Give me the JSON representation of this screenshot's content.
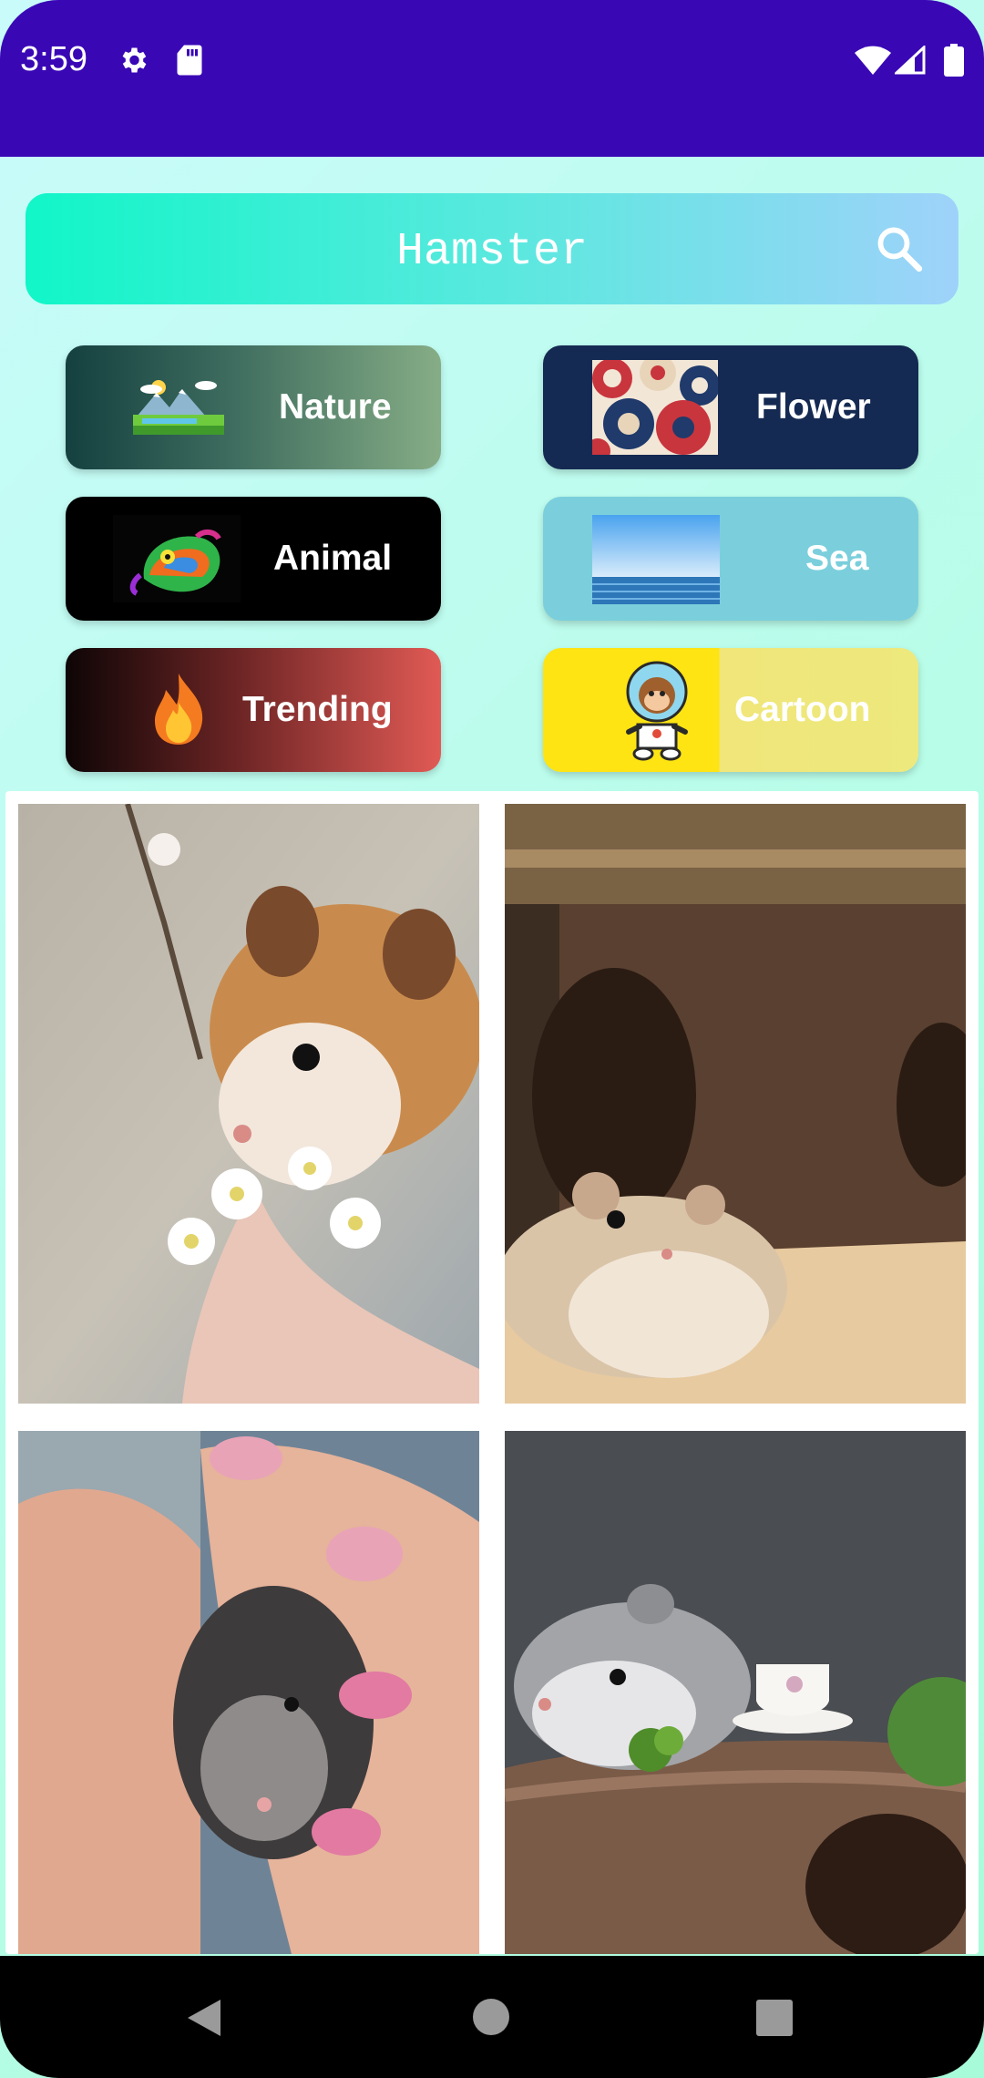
{
  "status_bar": {
    "time": "3:59",
    "left_icons": [
      "gear-icon",
      "sd-card-icon"
    ],
    "right_icons": [
      "wifi-icon",
      "signal-icon",
      "battery-icon"
    ],
    "background": "#3a07b5"
  },
  "search": {
    "value": "Hamster",
    "icon": "search-icon"
  },
  "categories": [
    {
      "label": "Nature",
      "icon": "nature-thumbnail"
    },
    {
      "label": "Flower",
      "icon": "flower-thumbnail"
    },
    {
      "label": "Animal",
      "icon": "chameleon-thumbnail"
    },
    {
      "label": "Sea",
      "icon": "sea-thumbnail"
    },
    {
      "label": "Trending",
      "icon": "fire-icon"
    },
    {
      "label": "Cartoon",
      "icon": "astronaut-monkey-thumbnail"
    }
  ],
  "results": [
    {
      "subject": "hamster-with-blossoms"
    },
    {
      "subject": "hamster-in-wooden-house"
    },
    {
      "subject": "hamster-in-hands"
    },
    {
      "subject": "hamster-with-teacup"
    }
  ],
  "nav_bar": {
    "buttons": [
      "back-icon",
      "home-icon",
      "recents-icon"
    ]
  }
}
